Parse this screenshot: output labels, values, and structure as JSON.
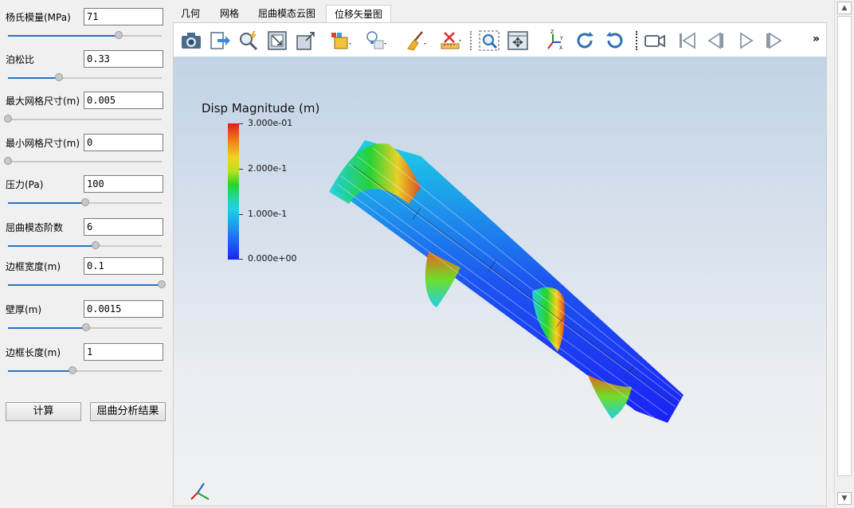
{
  "params": [
    {
      "label": "杨氏模量(MPa)",
      "value": "71",
      "slider_fraction": 0.72
    },
    {
      "label": "泊松比",
      "value": "0.33",
      "slider_fraction": 0.33
    },
    {
      "label": "最大网格尺寸(m)",
      "value": "0.005",
      "slider_fraction": 0.0
    },
    {
      "label": "最小网格尺寸(m)",
      "value": "0",
      "slider_fraction": 0.0
    },
    {
      "label": "压力(Pa)",
      "value": "100",
      "slider_fraction": 0.5
    },
    {
      "label": "屈曲模态阶数",
      "value": "6",
      "slider_fraction": 0.57
    },
    {
      "label": "边框宽度(m)",
      "value": "0.1",
      "slider_fraction": 1.0
    },
    {
      "label": "壁厚(m)",
      "value": "0.0015",
      "slider_fraction": 0.51
    },
    {
      "label": "边框长度(m)",
      "value": "1",
      "slider_fraction": 0.42
    }
  ],
  "buttons": {
    "compute": "计算",
    "results": "屈曲分析结果"
  },
  "tabs": [
    "几何",
    "网格",
    "屈曲模态云图",
    "位移矢量图"
  ],
  "active_tab": "位移矢量图",
  "toolbar": {
    "overflow": "»"
  },
  "toolbar_icons": [
    "camera-icon",
    "export-icon",
    "zoom-pick-icon",
    "fit-view-icon",
    "zoom-box-icon",
    "color-mode-icon",
    "light-icon",
    "clear-icon",
    "ruler-icon",
    "zoom-selection-icon",
    "reset-view-icon",
    "axes-icon",
    "rotate-cw-icon",
    "rotate-ccw-icon",
    "record-icon",
    "first-frame-icon",
    "prev-frame-icon",
    "play-icon",
    "next-frame-icon"
  ],
  "colorbar": {
    "title": "Disp Magnitude (m)",
    "ticks": [
      "3.000e-01",
      "2.000e-1",
      "1.000e-1",
      "0.000e+00"
    ],
    "colors": {
      "max": "#e11b1b",
      "min": "#1b22f5"
    }
  }
}
